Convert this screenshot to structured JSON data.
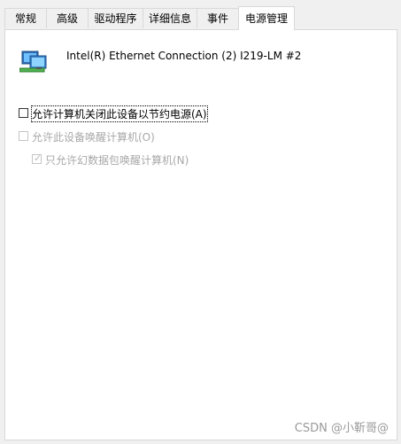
{
  "tabs": [
    {
      "label": "常规"
    },
    {
      "label": "高级"
    },
    {
      "label": "驱动程序"
    },
    {
      "label": "详细信息"
    },
    {
      "label": "事件"
    },
    {
      "label": "电源管理",
      "active": true
    }
  ],
  "device": {
    "name": "Intel(R) Ethernet Connection (2) I219-LM #2",
    "icon": "network-adapter-icon"
  },
  "options": {
    "allow_power_off": {
      "label": "允许计算机关闭此设备以节约电源(A)",
      "checked": false,
      "enabled": true
    },
    "allow_wake": {
      "label": "允许此设备唤醒计算机(O)",
      "checked": false,
      "enabled": false
    },
    "magic_packet_only": {
      "label": "只允许幻数据包唤醒计算机(N)",
      "checked": true,
      "enabled": false
    }
  },
  "watermark": "CSDN @小靳哥@"
}
